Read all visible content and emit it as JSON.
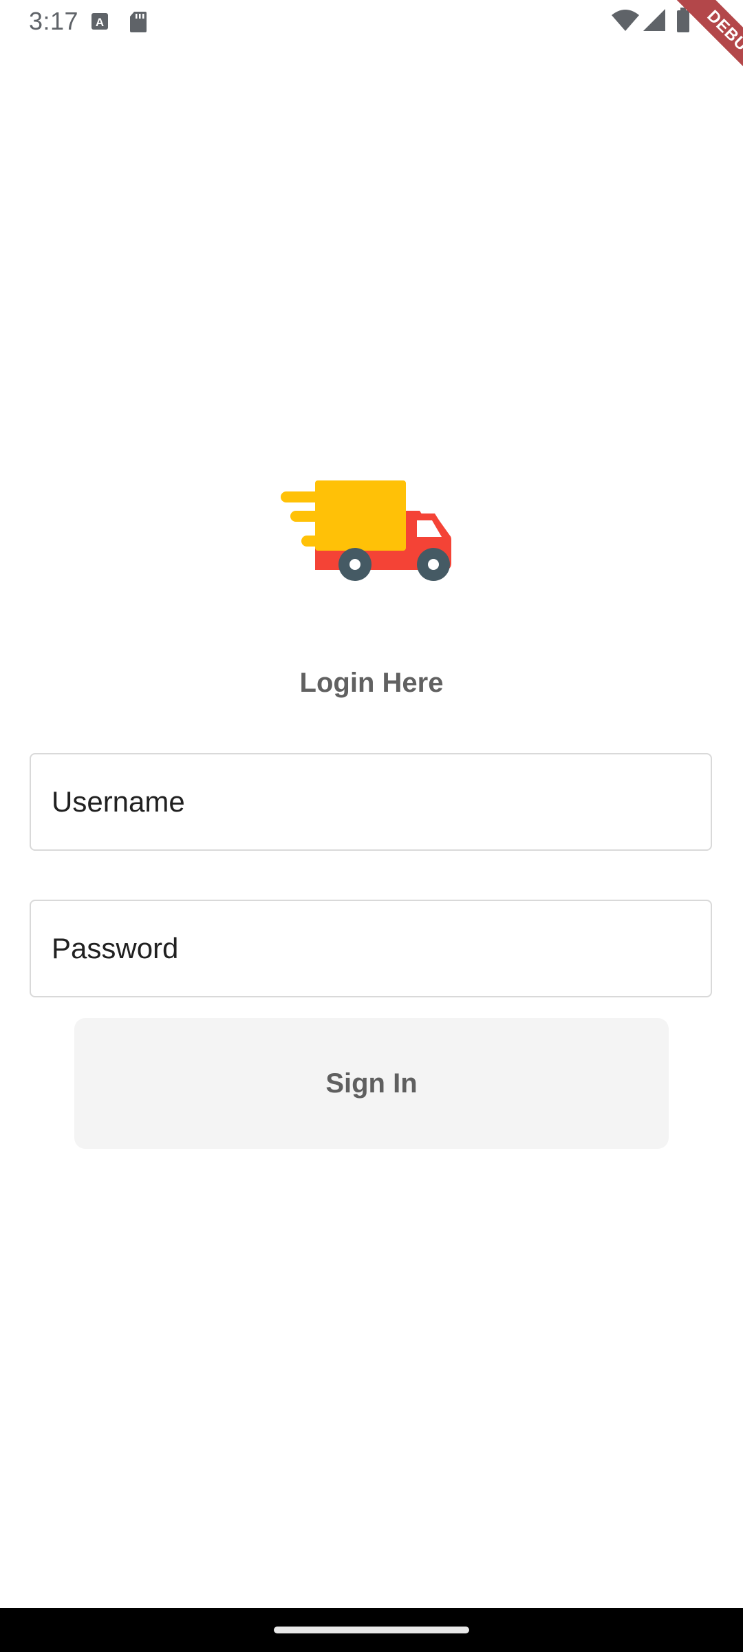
{
  "status_bar": {
    "time": "3:17",
    "left_icons": [
      "text-a-icon",
      "sd-card-icon"
    ],
    "right_icons": [
      "wifi-icon",
      "signal-icon",
      "battery-icon"
    ]
  },
  "debug_banner": {
    "label": "DEBUG",
    "color": "#b3474a"
  },
  "logo": {
    "icon": "delivery-truck-icon",
    "colors": {
      "cargo": "#ffc107",
      "cab": "#f44336",
      "wheels": "#455a64",
      "speed_lines": "#ffc107"
    }
  },
  "login": {
    "title": "Login Here",
    "username_placeholder": "Username",
    "username_value": "",
    "password_placeholder": "Password",
    "password_value": "",
    "sign_in_label": "Sign In"
  },
  "theme": {
    "background": "#ffffff",
    "field_border": "#d9d9d9",
    "button_background": "#f4f4f4",
    "title_color": "#616161"
  }
}
